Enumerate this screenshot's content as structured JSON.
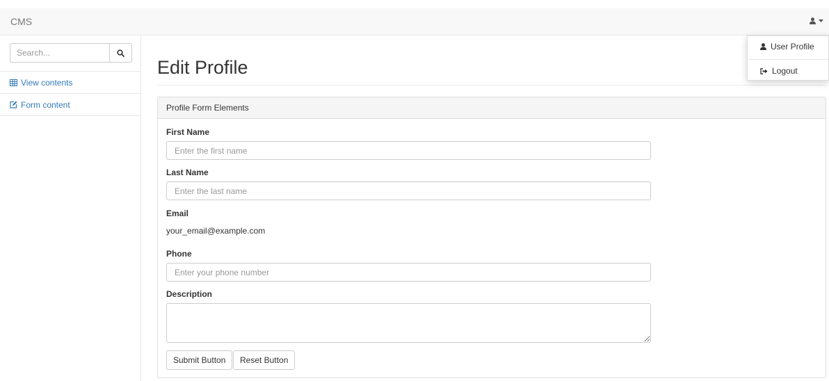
{
  "navbar": {
    "brand": "CMS",
    "user_icon": "user-icon",
    "caret_icon": "caret-down-icon"
  },
  "user_menu": {
    "items": [
      {
        "label": "User Profile",
        "icon": "user-icon"
      },
      {
        "label": "Logout",
        "icon": "sign-out-icon"
      }
    ]
  },
  "sidebar": {
    "search": {
      "placeholder": "Search...",
      "icon": "search-icon"
    },
    "items": [
      {
        "label": "View contents",
        "icon": "table-icon"
      },
      {
        "label": "Form content",
        "icon": "edit-icon"
      }
    ]
  },
  "main": {
    "title": "Edit Profile",
    "panel": {
      "heading": "Profile Form Elements",
      "fields": {
        "first_name": {
          "label": "First Name",
          "placeholder": "Enter the first name",
          "value": ""
        },
        "last_name": {
          "label": "Last Name",
          "placeholder": "Enter the last name",
          "value": ""
        },
        "email": {
          "label": "Email",
          "value": "your_email@example.com"
        },
        "phone": {
          "label": "Phone",
          "placeholder": "Enter your phone number",
          "value": ""
        },
        "description": {
          "label": "Description",
          "value": ""
        }
      },
      "buttons": {
        "submit": "Submit Button",
        "reset": "Reset Button"
      }
    }
  },
  "colors": {
    "link": "#337ab7",
    "navbar_bg": "#f8f8f8",
    "panel_heading_bg": "#f5f5f5",
    "border": "#dddddd"
  }
}
